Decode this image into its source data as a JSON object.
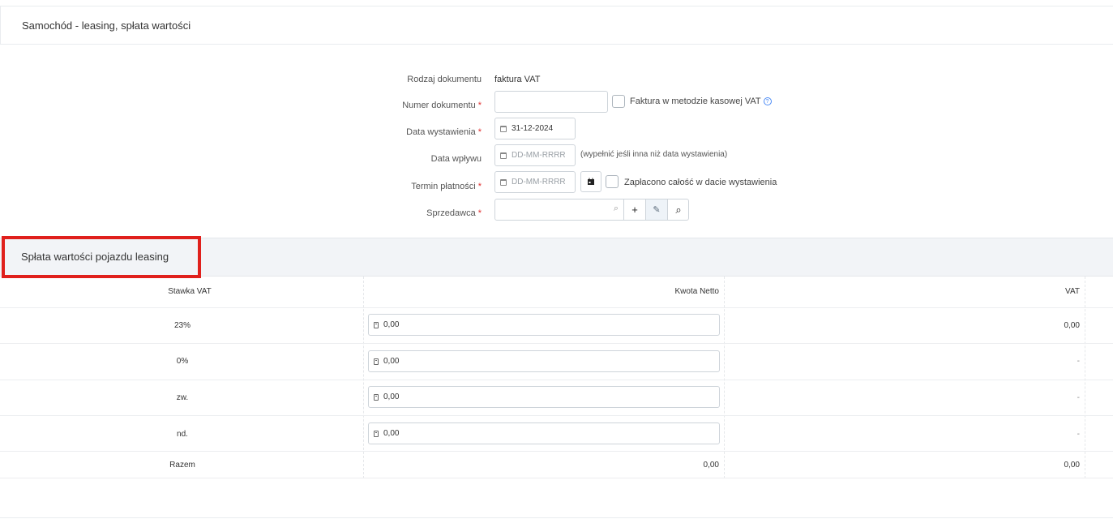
{
  "panel": {
    "title": "Samochód - leasing, spłata wartości"
  },
  "form": {
    "doc_type": {
      "label": "Rodzaj dokumentu",
      "value": "faktura VAT"
    },
    "doc_number": {
      "label": "Numer dokumentu",
      "required_mark": "*",
      "value": ""
    },
    "cash_method": {
      "label": "Faktura w metodzie kasowej VAT",
      "help": "?"
    },
    "issue_date": {
      "label": "Data wystawienia",
      "required_mark": "*",
      "value": "31-12-2024"
    },
    "receipt_date": {
      "label": "Data wpływu",
      "placeholder": "DD-MM-RRRR",
      "hint": "(wypełnić jeśli inna niż data wystawienia)"
    },
    "payment_due": {
      "label": "Termin płatności",
      "required_mark": "*",
      "placeholder": "DD-MM-RRRR"
    },
    "paid_full": {
      "label": "Zapłacono całość w dacie wystawienia"
    },
    "vendor": {
      "label": "Sprzedawca",
      "required_mark": "*",
      "value": "",
      "add_glyph": "+",
      "edit_glyph": "✎",
      "search_glyph": "⌕",
      "inner_search_glyph": "⌕"
    }
  },
  "section": {
    "title": "Spłata wartości pojazdu leasing"
  },
  "table": {
    "headers": {
      "rate": "Stawka VAT",
      "net": "Kwota Netto",
      "vat": "VAT"
    },
    "rows": [
      {
        "rate": "23%",
        "net": "0,00",
        "vat": "0,00"
      },
      {
        "rate": "0%",
        "net": "0,00",
        "vat": "-"
      },
      {
        "rate": "zw.",
        "net": "0,00",
        "vat": "-"
      },
      {
        "rate": "nd.",
        "net": "0,00",
        "vat": "-"
      }
    ],
    "total": {
      "label": "Razem",
      "net": "0,00",
      "vat": "0,00"
    }
  },
  "colors": {
    "required": "#e03131",
    "highlight": "#e0201c",
    "section_bg": "#f2f4f7",
    "help": "#4c8bf5"
  }
}
